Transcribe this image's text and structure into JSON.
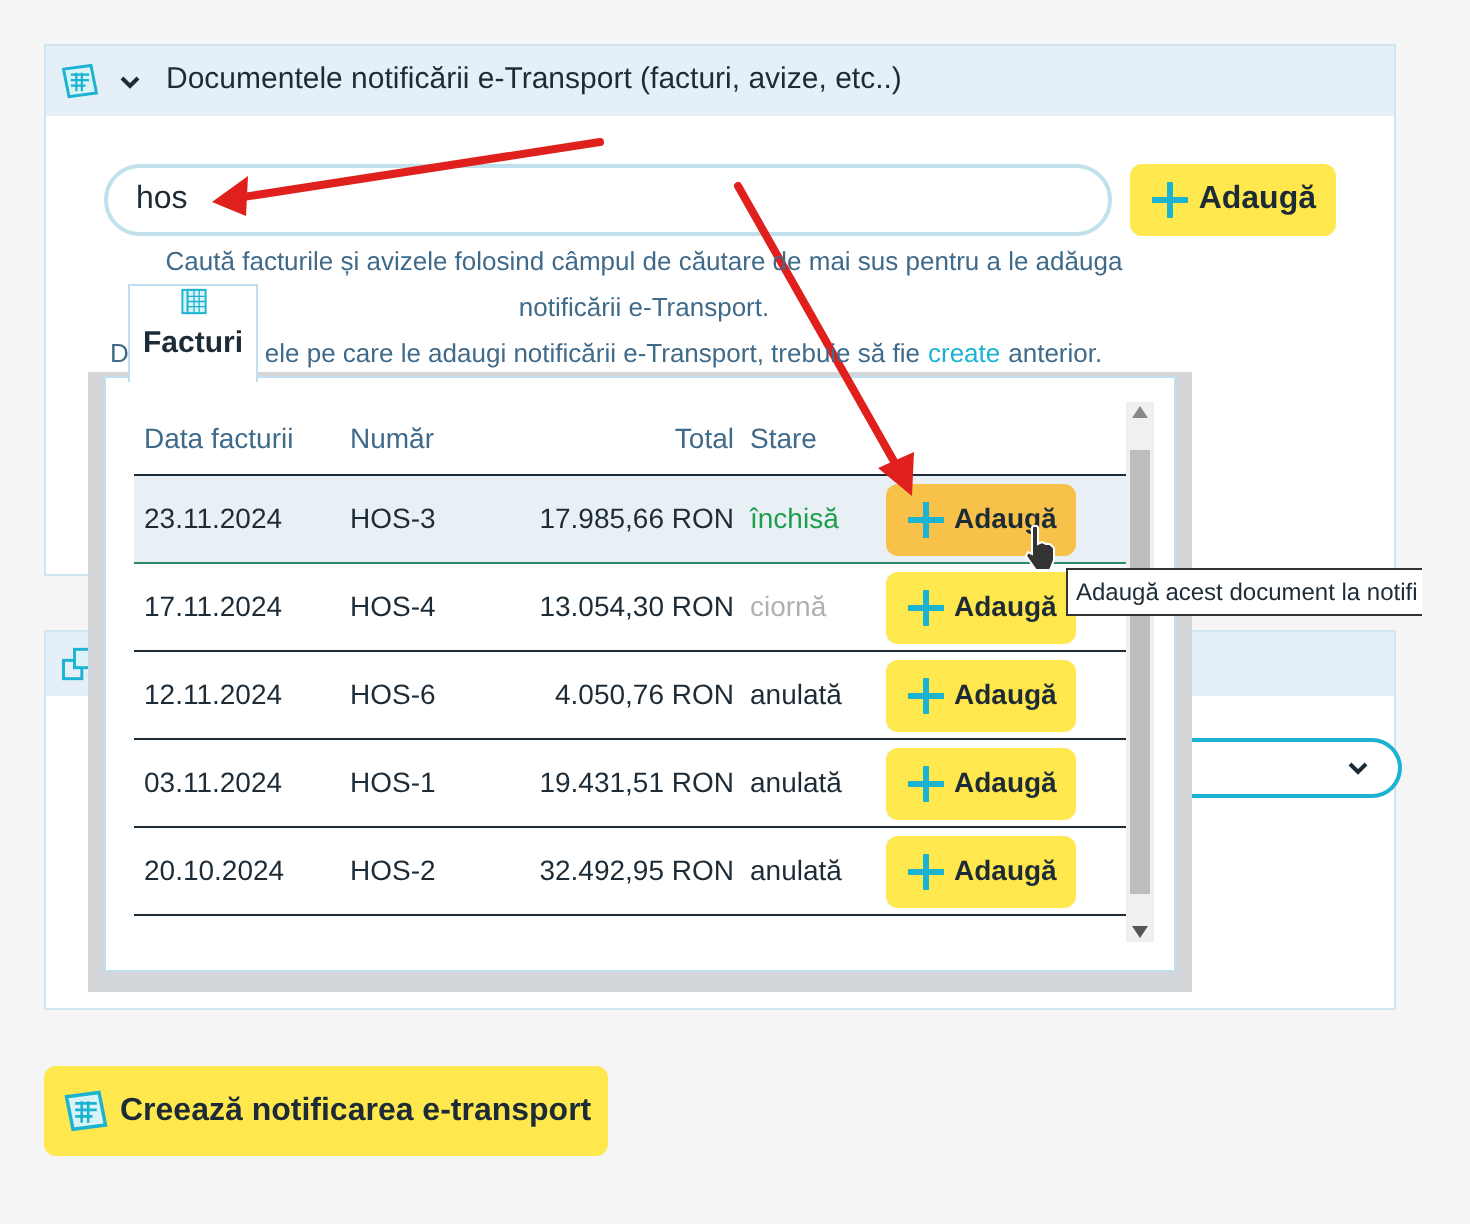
{
  "documents_panel": {
    "title": "Documentele notificării e-Transport (facturi, avize, etc..)",
    "expanded": true,
    "search": {
      "value": "hos"
    },
    "add_button": "Adaugă",
    "hint_line_1": "Caută facturile și avizele folosind câmpul de căutare de mai sus pentru a le adăuga",
    "hint_line_2": "notificării e-Transport.",
    "hint_line_3_start": "D",
    "hint_line_3_rest": "ele pe care le adaugi notificării e-Transport, trebuie să fie",
    "hint_link": "create",
    "hint_line_3_end": "anterior."
  },
  "results_popup": {
    "tab": "Facturi",
    "columns": [
      "Data facturii",
      "Număr",
      "Total",
      "Stare"
    ],
    "rows": [
      {
        "date": "23.11.2024",
        "number": "HOS-3",
        "total": "17.985,66 RON",
        "status": "închisă",
        "kind": "closed",
        "hovered": true,
        "button": "Adaugă"
      },
      {
        "date": "17.11.2024",
        "number": "HOS-4",
        "total": "13.054,30 RON",
        "status": "ciornă",
        "kind": "draft",
        "hovered": false,
        "button": "Adaugă"
      },
      {
        "date": "12.11.2024",
        "number": "HOS-6",
        "total": "4.050,76 RON",
        "status": "anulată",
        "kind": "cancelled",
        "hovered": false,
        "button": "Adaugă"
      },
      {
        "date": "03.11.2024",
        "number": "HOS-1",
        "total": "19.431,51 RON",
        "status": "anulată",
        "kind": "cancelled",
        "hovered": false,
        "button": "Adaugă"
      },
      {
        "date": "20.10.2024",
        "number": "HOS-2",
        "total": "32.492,95 RON",
        "status": "anulată",
        "kind": "cancelled",
        "hovered": false,
        "button": "Adaugă"
      }
    ]
  },
  "tooltip": "Adaugă acest document la notifi",
  "create_button": "Creează notificarea e-transport"
}
